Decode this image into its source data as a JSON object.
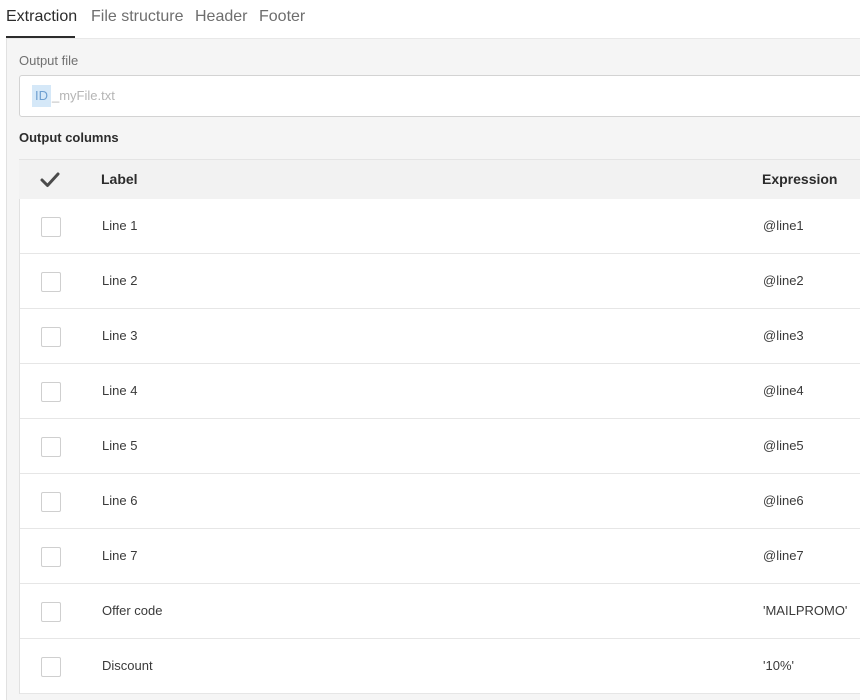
{
  "tabs": [
    {
      "label": "Extraction",
      "active": true
    },
    {
      "label": "File structure",
      "active": false
    },
    {
      "label": "Header",
      "active": false
    },
    {
      "label": "Footer",
      "active": false
    }
  ],
  "output_file": {
    "label": "Output file",
    "id_token": "ID",
    "value": "_myFile.txt"
  },
  "output_columns": {
    "title": "Output columns",
    "header": {
      "label": "Label",
      "expression": "Expression"
    },
    "rows": [
      {
        "label": "Line 1",
        "expression": "@line1"
      },
      {
        "label": "Line 2",
        "expression": "@line2"
      },
      {
        "label": "Line 3",
        "expression": "@line3"
      },
      {
        "label": "Line 4",
        "expression": "@line4"
      },
      {
        "label": "Line 5",
        "expression": "@line5"
      },
      {
        "label": "Line 6",
        "expression": "@line6"
      },
      {
        "label": "Line 7",
        "expression": "@line7"
      },
      {
        "label": "Offer code",
        "expression": "'MAILPROMO'"
      },
      {
        "label": "Discount",
        "expression": "'10%'"
      }
    ]
  },
  "colors": {
    "accent_underline": "#2c2c2c",
    "id_chip_bg": "#d5e8f8",
    "id_chip_text": "#6e9fd0"
  },
  "icons": {
    "select_all": "checkmark-icon"
  }
}
